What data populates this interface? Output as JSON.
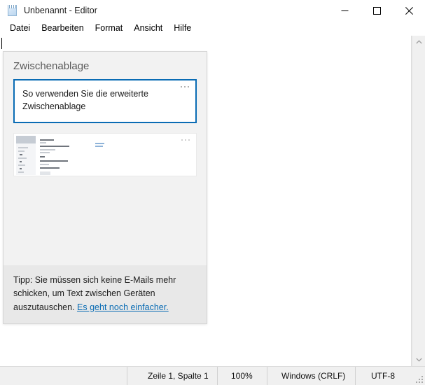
{
  "window": {
    "title": "Unbenannt - Editor",
    "icon": "notepad-icon",
    "minimize_label": "─",
    "maximize_label": "□",
    "close_label": "✕"
  },
  "menubar": {
    "items": [
      {
        "label": "Datei"
      },
      {
        "label": "Bearbeiten"
      },
      {
        "label": "Format"
      },
      {
        "label": "Ansicht"
      },
      {
        "label": "Hilfe"
      }
    ]
  },
  "editor": {
    "content": "",
    "caret_visible": true
  },
  "clipboard": {
    "header": "Zwischenablage",
    "items": [
      {
        "type": "text",
        "text": "So verwenden Sie die erweiterte\nZwischenablage",
        "selected": true,
        "menu_icon": "ellipsis-icon"
      },
      {
        "type": "image",
        "text": "",
        "selected": false,
        "menu_icon": "ellipsis-icon"
      }
    ],
    "tip": {
      "text": "Tipp: Sie müssen sich keine E-Mails mehr schicken, um Text zwischen Geräten auszutauschen. ",
      "link_text": "Es geht noch einfacher."
    }
  },
  "scrollbar": {
    "up_icon": "chevron-up-icon",
    "down_icon": "chevron-down-icon"
  },
  "statusbar": {
    "position": "Zeile 1, Spalte 1",
    "zoom": "100%",
    "line_ending": "Windows (CRLF)",
    "encoding": "UTF-8"
  },
  "colors": {
    "accent": "#0a6cb4",
    "link": "#0a6cb4",
    "panel_bg": "#f2f2f2",
    "tip_bg": "#e8e8e8",
    "status_bg": "#f0f0f0"
  }
}
